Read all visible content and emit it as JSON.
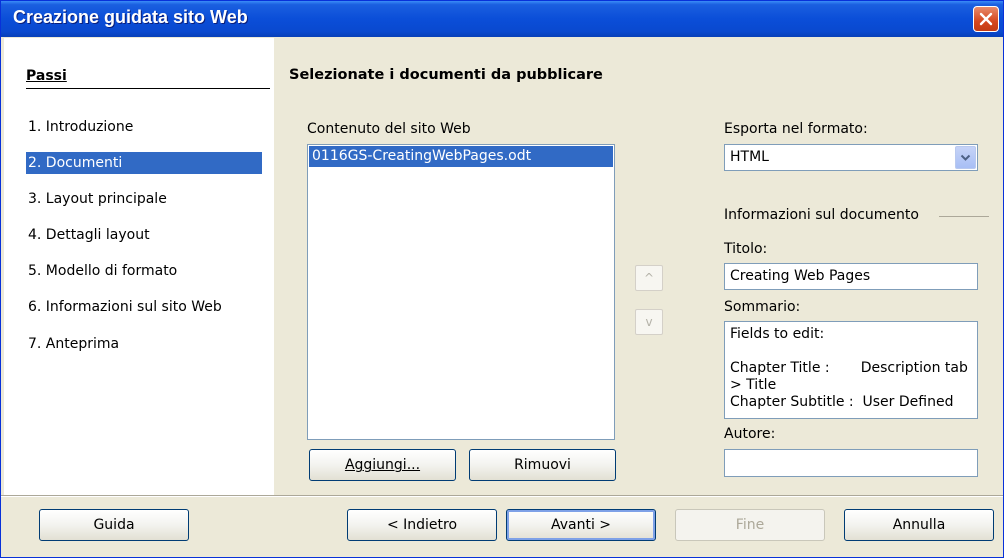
{
  "window": {
    "title": "Creazione guidata sito Web"
  },
  "steps": {
    "header": "Passi",
    "items": [
      {
        "label": "1.  Introduzione",
        "selected": false
      },
      {
        "label": "2.  Documenti",
        "selected": true
      },
      {
        "label": "3.  Layout principale",
        "selected": false
      },
      {
        "label": "4.  Dettagli layout",
        "selected": false
      },
      {
        "label": "5.  Modello di formato",
        "selected": false
      },
      {
        "label": "6.  Informazioni sul sito Web",
        "selected": false
      },
      {
        "label": "7.  Anteprima",
        "selected": false
      }
    ]
  },
  "main": {
    "heading": "Selezionate i documenti da pubblicare",
    "content_label": "Contenuto del sito Web",
    "documents": [
      "0116GS-CreatingWebPages.odt"
    ],
    "add_button": "Aggiungi...",
    "remove_button": "Rimuovi",
    "move_up": "^",
    "move_down": "v"
  },
  "export": {
    "label": "Esporta nel formato:",
    "selected": "HTML"
  },
  "docinfo": {
    "section_label": "Informazioni sul documento",
    "title_label": "Titolo:",
    "title_value": "Creating Web Pages",
    "summary_label": "Sommario:",
    "summary_value": "Fields to edit:\n\nChapter Title :       Description tab > Title\nChapter Subtitle :  User Defined",
    "author_label": "Autore:",
    "author_value": ""
  },
  "footer": {
    "help": "Guida",
    "back": "< Indietro",
    "next": "Avanti >",
    "finish": "Fine",
    "cancel": "Annulla"
  },
  "colors": {
    "selection": "#316ac5",
    "titlebar": "#0b4ed8",
    "dialog": "#ece9d8"
  }
}
